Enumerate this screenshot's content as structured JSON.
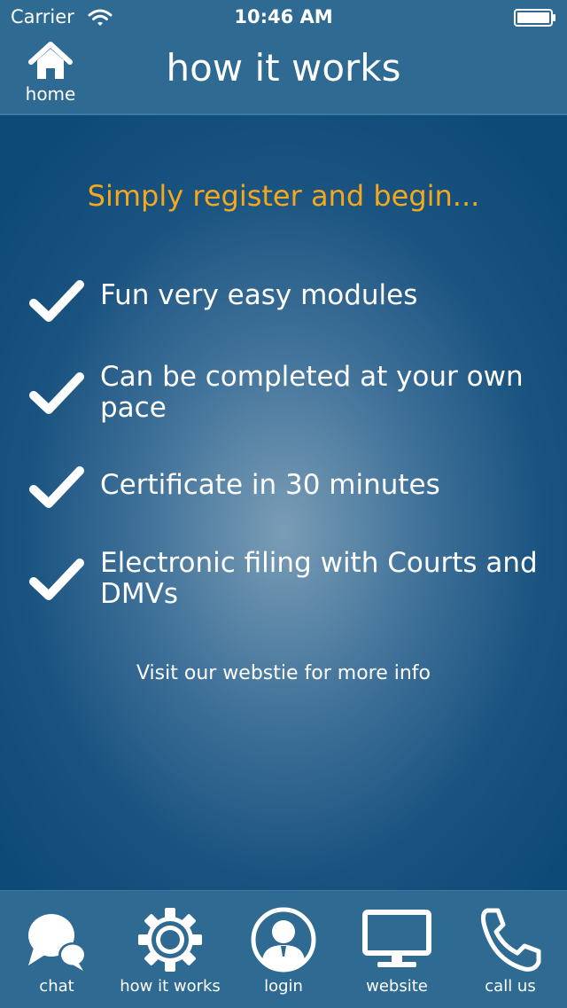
{
  "status_bar": {
    "carrier": "Carrier",
    "time": "10:46 AM"
  },
  "nav": {
    "home_label": "home",
    "title": "how it works"
  },
  "content": {
    "headline": "Simply register and begin...",
    "features": [
      "Fun very easy modules",
      "Can be completed at your own pace",
      "Certificate in 30 minutes",
      "Electronic filing with Courts and DMVs"
    ],
    "link": "Visit our webstie for more info"
  },
  "tabs": [
    {
      "label": "chat",
      "icon": "chat-bubbles-icon"
    },
    {
      "label": "how it works",
      "icon": "gear-icon"
    },
    {
      "label": "login",
      "icon": "user-icon"
    },
    {
      "label": "website",
      "icon": "monitor-icon"
    },
    {
      "label": "call us",
      "icon": "phone-icon"
    }
  ],
  "colors": {
    "bar": "#2e6a91",
    "accent": "#f4a81d",
    "background": "#1a5380"
  }
}
